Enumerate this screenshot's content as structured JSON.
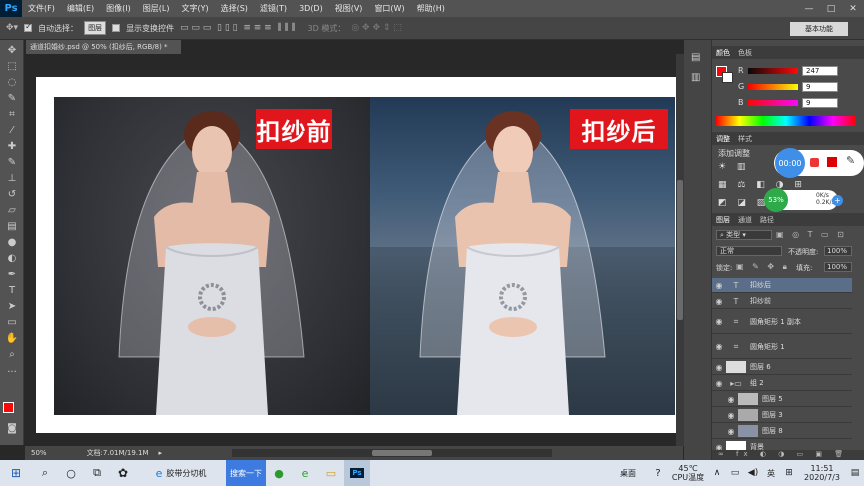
{
  "menubar": {
    "logo": "Ps",
    "items": [
      "文件(F)",
      "编辑(E)",
      "图像(I)",
      "图层(L)",
      "文字(Y)",
      "选择(S)",
      "滤镜(T)",
      "3D(D)",
      "视图(V)",
      "窗口(W)",
      "帮助(H)"
    ],
    "min": "—",
    "max": "□",
    "close": "✕"
  },
  "options": {
    "auto_select_label": "自动选择：",
    "auto_select_value": "图层",
    "show_transform_label": "显示变换控件",
    "mode_3d_label": "3D 模式：",
    "workspace": "基本功能"
  },
  "document": {
    "tab_title": "通道扣婚纱.psd @ 50% (扣纱后, RGB/8) *",
    "label_before": "扣纱前",
    "label_after": "扣纱后"
  },
  "status": {
    "zoom": "50%",
    "doc_info": "文档:7.01M/19.1M"
  },
  "color_panel": {
    "tabs": [
      "颜色",
      "色板"
    ],
    "channels": [
      {
        "name": "R",
        "value": "247"
      },
      {
        "name": "G",
        "value": "9"
      },
      {
        "name": "B",
        "value": "9"
      }
    ],
    "fg_color": "#f70909"
  },
  "adjust_panel": {
    "tabs": [
      "调整",
      "样式"
    ],
    "title": "添加调整"
  },
  "recorder": {
    "time": "00:00",
    "percent": "53%",
    "up_speed": "0K/s",
    "down_speed": "0.2K/s"
  },
  "layers_panel": {
    "tabs": [
      "图层",
      "通道",
      "路径"
    ],
    "kind_label": "类型",
    "blend_mode": "正常",
    "opacity_label": "不透明度:",
    "opacity_value": "100%",
    "lock_label": "锁定:",
    "fill_label": "填充:",
    "fill_value": "100%",
    "layers": [
      {
        "name": "扣纱后",
        "type": "text",
        "selected": true
      },
      {
        "name": "扣纱前",
        "type": "text",
        "selected": false
      },
      {
        "name": "圆角矩形 1 副本",
        "type": "shape",
        "selected": false
      },
      {
        "name": "圆角矩形 1",
        "type": "shape",
        "selected": false
      },
      {
        "name": "图层 6",
        "type": "image",
        "selected": false
      },
      {
        "name": "组 2",
        "type": "group",
        "selected": false
      },
      {
        "name": "图层 5",
        "type": "image",
        "selected": false
      },
      {
        "name": "图层 3",
        "type": "image",
        "selected": false
      },
      {
        "name": "图层 8",
        "type": "image",
        "selected": false
      },
      {
        "name": "背景",
        "type": "image",
        "selected": false
      }
    ]
  },
  "taskbar": {
    "app1": "胶带分切机",
    "search_btn": "搜索一下",
    "desktop": "桌面",
    "temp": "45℃",
    "temp_label": "CPU温度",
    "lang": "英",
    "time": "11:51",
    "date": "2020/7/3"
  }
}
